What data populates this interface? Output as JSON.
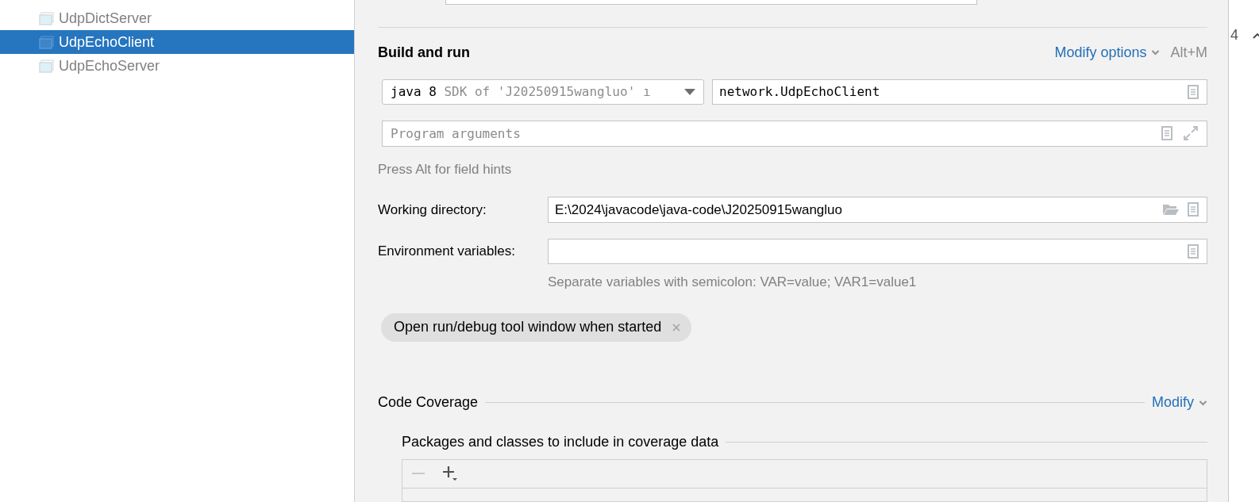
{
  "tree": {
    "items": [
      {
        "label": "UdpDictServer",
        "selected": false
      },
      {
        "label": "UdpEchoClient",
        "selected": true
      },
      {
        "label": "UdpEchoServer",
        "selected": false
      }
    ]
  },
  "build_and_run": {
    "title": "Build and run",
    "modify_options": "Modify options",
    "shortcut": "Alt+M",
    "jre": {
      "value": "java 8",
      "hint": "SDK of 'J20250915wangluo' ı"
    },
    "main_class": {
      "value": "network.UdpEchoClient"
    },
    "program_arguments": {
      "placeholder": "Program arguments"
    },
    "field_hint": "Press Alt for field hints",
    "working_directory": {
      "label": "Working directory:",
      "value": "E:\\2024\\javacode\\java-code\\J20250915wangluo"
    },
    "environment_variables": {
      "label": "Environment variables:",
      "hint": "Separate variables with semicolon: VAR=value; VAR1=value1"
    },
    "chip": {
      "label": "Open run/debug tool window when started"
    }
  },
  "code_coverage": {
    "title": "Code Coverage",
    "modify": "Modify",
    "packages_title": "Packages and classes to include in coverage data"
  },
  "side_strip": {
    "text": "4"
  }
}
